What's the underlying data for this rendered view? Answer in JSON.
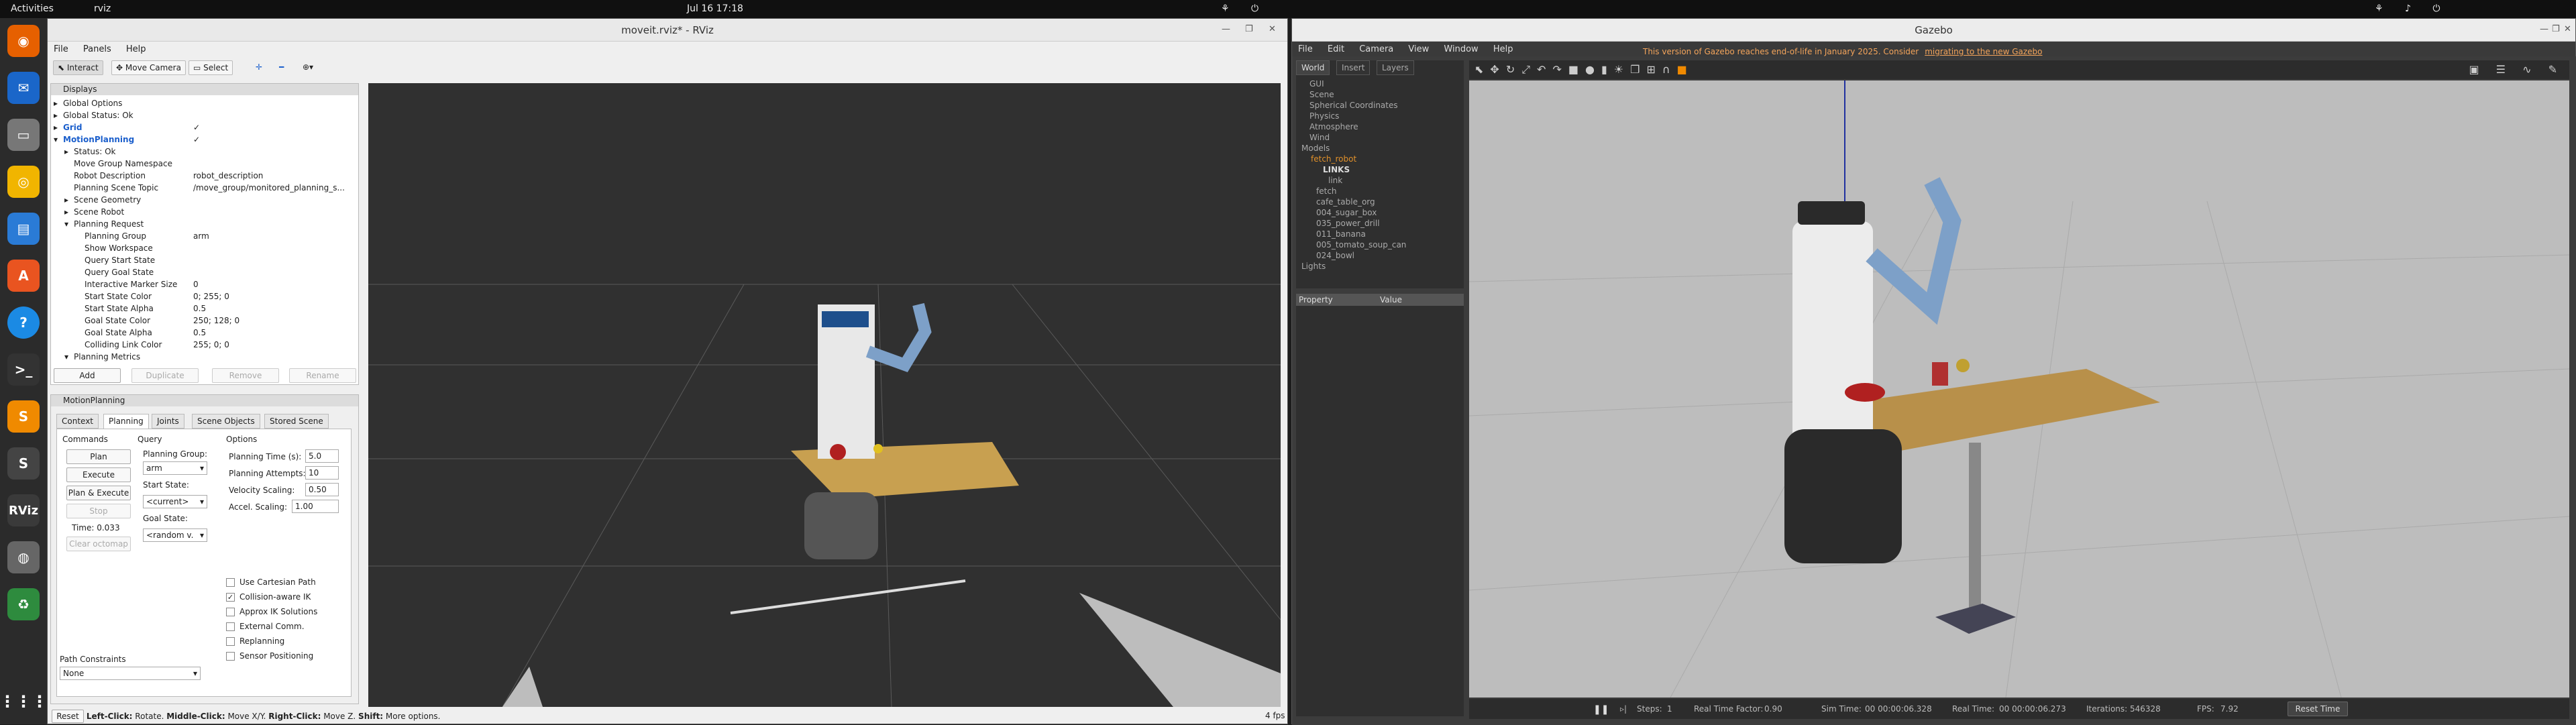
{
  "topbar": {
    "activities": "Activities",
    "app": "rviz",
    "clock": "Jul 16  17:18"
  },
  "dock": [
    "firefox",
    "thunderbird",
    "files",
    "rhythmbox",
    "writer",
    "software",
    "help",
    "terminal",
    "sublime",
    "sublime-text",
    "rviz",
    "disks",
    "trash",
    "apps-grid"
  ],
  "rviz": {
    "title": "moveit.rviz* - RViz",
    "menu": [
      "File",
      "Panels",
      "Help"
    ],
    "toolbar": {
      "interact": "Interact",
      "move_camera": "Move Camera",
      "select": "Select"
    },
    "displays": {
      "header": "Displays",
      "items": [
        {
          "label": "Global Options",
          "value": ""
        },
        {
          "label": "Global Status: Ok",
          "value": ""
        },
        {
          "label": "Grid",
          "value": "✓"
        },
        {
          "label": "MotionPlanning",
          "value": "✓"
        },
        {
          "label": "Status: Ok",
          "value": ""
        },
        {
          "label": "Move Group Namespace",
          "value": ""
        },
        {
          "label": "Robot Description",
          "value": "robot_description"
        },
        {
          "label": "Planning Scene Topic",
          "value": "/move_group/monitored_planning_s..."
        },
        {
          "label": "Scene Geometry",
          "value": ""
        },
        {
          "label": "Scene Robot",
          "value": ""
        },
        {
          "label": "Planning Request",
          "value": ""
        },
        {
          "label": "Planning Group",
          "value": "arm"
        },
        {
          "label": "Show Workspace",
          "value": ""
        },
        {
          "label": "Query Start State",
          "value": ""
        },
        {
          "label": "Query Goal State",
          "value": ""
        },
        {
          "label": "Interactive Marker Size",
          "value": "0"
        },
        {
          "label": "Start State Color",
          "value": "0; 255; 0"
        },
        {
          "label": "Start State Alpha",
          "value": "0.5"
        },
        {
          "label": "Goal State Color",
          "value": "250; 128; 0"
        },
        {
          "label": "Goal State Alpha",
          "value": "0.5"
        },
        {
          "label": "Colliding Link Color",
          "value": "255; 0; 0"
        },
        {
          "label": "Planning Metrics",
          "value": ""
        }
      ],
      "buttons": {
        "add": "Add",
        "duplicate": "Duplicate",
        "remove": "Remove",
        "rename": "Rename"
      }
    },
    "motion_planning": {
      "header": "MotionPlanning",
      "tabs": [
        "Context",
        "Planning",
        "Joints",
        "Scene Objects",
        "Stored Scene"
      ],
      "commands_label": "Commands",
      "query_label": "Query",
      "options_label": "Options",
      "plan": "Plan",
      "execute": "Execute",
      "plan_execute": "Plan & Execute",
      "stop": "Stop",
      "time": "Time: 0.033",
      "clear_octomap": "Clear octomap",
      "planning_group_label": "Planning Group:",
      "planning_group": "arm",
      "start_state_label": "Start State:",
      "start_state": "<current>",
      "goal_state_label": "Goal State:",
      "goal_state": "<random v.",
      "planning_time_label": "Planning Time (s):",
      "planning_time": "5.0",
      "planning_attempts_label": "Planning Attempts:",
      "planning_attempts": "10",
      "velocity_label": "Velocity Scaling:",
      "velocity": "0.50",
      "accel_label": "Accel. Scaling:",
      "accel": "1.00",
      "checks": [
        {
          "label": "Use Cartesian Path",
          "checked": ""
        },
        {
          "label": "Collision-aware IK",
          "checked": "✓"
        },
        {
          "label": "Approx IK Solutions",
          "checked": ""
        },
        {
          "label": "External Comm.",
          "checked": ""
        },
        {
          "label": "Replanning",
          "checked": ""
        },
        {
          "label": "Sensor Positioning",
          "checked": ""
        }
      ],
      "path_constraints_label": "Path Constraints",
      "path_constraints": "None"
    },
    "status": {
      "reset": "Reset",
      "hint_bold1": "Left-Click:",
      "hint1": " Rotate. ",
      "hint_bold2": "Middle-Click:",
      "hint2": " Move X/Y. ",
      "hint_bold3": "Right-Click:",
      "hint3": " Move Z. ",
      "hint_bold4": "Shift:",
      "hint4": " More options.",
      "fps": "4 fps"
    }
  },
  "gazebo": {
    "title": "Gazebo",
    "menu": [
      "File",
      "Edit",
      "Camera",
      "View",
      "Window",
      "Help"
    ],
    "notice": "This version of Gazebo reaches end-of-life in January 2025. Consider ",
    "notice_link": "migrating to the new Gazebo",
    "tabs": [
      "World",
      "Insert",
      "Layers"
    ],
    "tree": [
      "GUI",
      "Scene",
      "Spherical Coordinates",
      "Physics",
      "Atmosphere",
      "Wind",
      "Models",
      "fetch_robot",
      "LINKS",
      "link",
      "fetch",
      "cafe_table_org",
      "004_sugar_box",
      "035_power_drill",
      "011_banana",
      "005_tomato_soup_can",
      "024_bowl",
      "Lights"
    ],
    "prop_header": "Property",
    "value_header": "Value",
    "bottom": {
      "steps_label": "Steps:",
      "steps": "1",
      "rtf_label": "Real Time Factor:",
      "rtf": "0.90",
      "sim_label": "Sim Time:",
      "sim": "00 00:00:06.328",
      "real_label": "Real Time:",
      "real": "00 00:00:06.273",
      "iter_label": "Iterations:",
      "iter": "546328",
      "fps_label": "FPS:",
      "fps": "7.92",
      "reset_time": "Reset Time"
    }
  }
}
